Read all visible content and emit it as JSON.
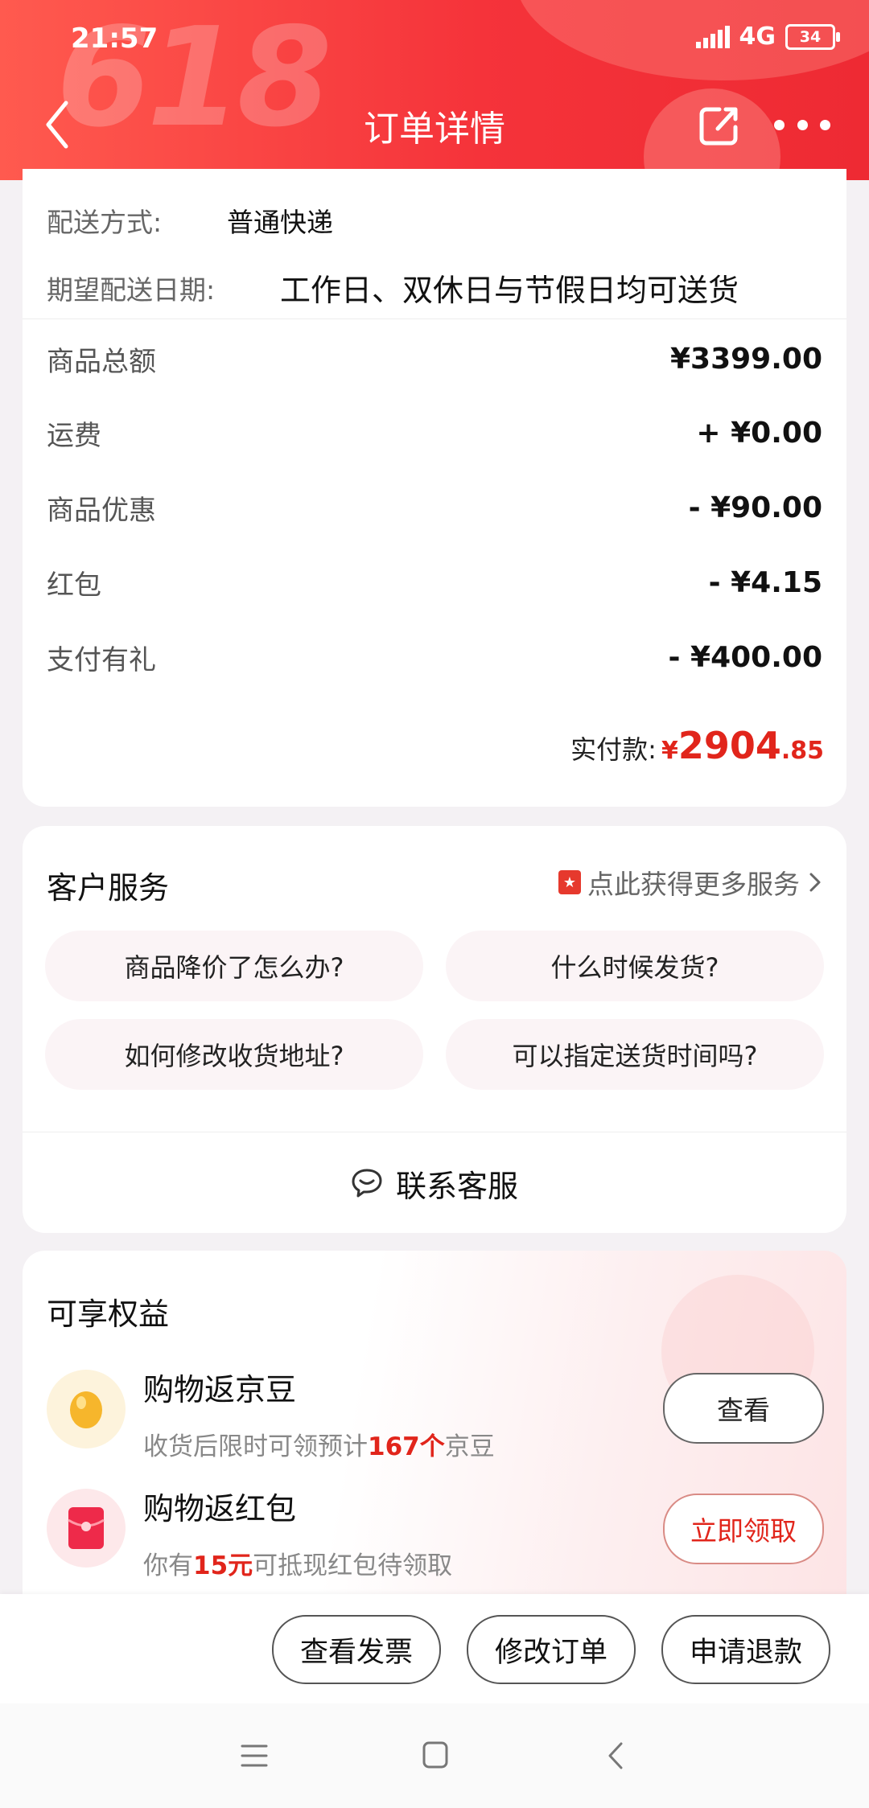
{
  "status_bar": {
    "time": "21:57",
    "network": "4G",
    "battery": "34"
  },
  "header": {
    "title": "订单详情",
    "bg_text": "618"
  },
  "shipping": {
    "method_label": "配送方式:",
    "method_value": "普通快递",
    "date_label": "期望配送日期:",
    "date_value": "工作日、双休日与节假日均可送货"
  },
  "prices": [
    {
      "label": "商品总额",
      "value": "¥3399.00"
    },
    {
      "label": "运费",
      "value": "+ ¥0.00"
    },
    {
      "label": "商品优惠",
      "value": "- ¥90.00"
    },
    {
      "label": "红包",
      "value": "- ¥4.15"
    },
    {
      "label": "支付有礼",
      "value": "- ¥400.00"
    }
  ],
  "paid": {
    "label": "实付款:",
    "currency": "¥",
    "integer": "2904",
    "decimal": ".85"
  },
  "service": {
    "title": "客户服务",
    "more_label": "点此获得更多服务",
    "questions": [
      "商品降价了怎么办?",
      "什么时候发货?",
      "如何修改收货地址?",
      "可以指定送货时间吗?"
    ],
    "contact_label": "联系客服"
  },
  "benefits": {
    "title": "可享权益",
    "items": [
      {
        "name": "购物返京豆",
        "desc_pre": "收货后限时可领预计",
        "desc_highlight": "167个",
        "desc_post": "京豆",
        "button": "查看"
      },
      {
        "name": "购物返红包",
        "desc_pre": "你有",
        "desc_highlight": "15元",
        "desc_post": "可抵现红包待领取",
        "button": "立即领取"
      }
    ]
  },
  "actions": {
    "invoice": "查看发票",
    "modify": "修改订单",
    "refund": "申请退款"
  },
  "colors": {
    "brand_red": "#e1251b",
    "header_red": "#f5333a"
  }
}
